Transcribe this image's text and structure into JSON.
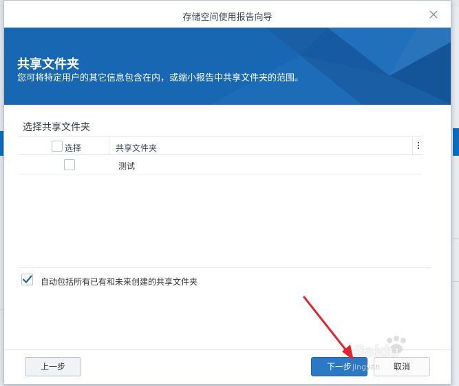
{
  "dialog": {
    "title": "存储空间使用报告向导",
    "banner_title": "共享文件夹",
    "banner_subtitle": "您可将特定用户的其它信息包含在内，或缩小报告中共享文件夹的范围。"
  },
  "section": {
    "title": "选择共享文件夹"
  },
  "grid": {
    "columns": [
      "选择",
      "共享文件夹"
    ],
    "rows": [
      {
        "name": "测试",
        "checked": false
      }
    ]
  },
  "auto_include": {
    "label": "自动包括所有已有和未来创建的共享文件夹",
    "checked": true
  },
  "buttons": {
    "prev": "上一步",
    "next": "下一步",
    "cancel": "取消"
  },
  "watermark": {
    "text": "Baidu",
    "sub": "jingyan"
  },
  "colors": {
    "banner": "#1565b0",
    "primary_button": "#2b79c5",
    "annotation_arrow": "#e8202a"
  }
}
